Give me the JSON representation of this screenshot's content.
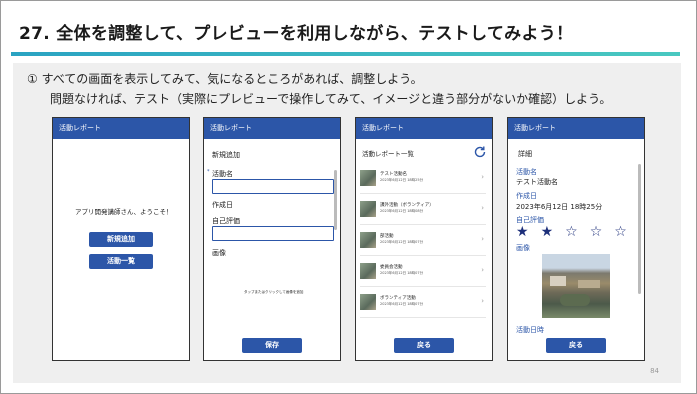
{
  "slide": {
    "title": "27. 全体を調整して、プレビューを利用しながら、テストしてみよう！",
    "line1": "① すべての画面を表示してみて、気になるところがあれば、調整しよう。",
    "line2": "問題なければ、テスト（実際にプレビューで操作してみて、イメージと違う部分がないか確認）しよう。",
    "page_number": "84"
  },
  "colors": {
    "header": "#2c56a8",
    "title_rule": "#2aa3c2",
    "star": "#1d2f7a"
  },
  "phones": {
    "home": {
      "header": "活動レポート",
      "welcome": "アプリ開発講師さん、ようこそ！",
      "btn_new": "新規追加",
      "btn_list": "活動一覧"
    },
    "new": {
      "header": "活動レポート",
      "heading": "新規追加",
      "label_name": "活動名",
      "label_date": "作成日",
      "label_eval": "自己評価",
      "label_image": "画像",
      "image_hint": "タップまたはクリックして画像を追加",
      "btn_save": "保存"
    },
    "list": {
      "header": "活動レポート",
      "heading": "活動レポート一覧",
      "refresh_icon": "refresh-icon",
      "items": [
        {
          "name": "テスト活動名",
          "date": "2023年6月12日 18時25分"
        },
        {
          "name": "課外活動（ボランティア）",
          "date": "2023年6月12日 18時08分"
        },
        {
          "name": "部活動",
          "date": "2023年6月12日 18時07分"
        },
        {
          "name": "委員会活動",
          "date": "2023年6月12日 18時07分"
        },
        {
          "name": "ボランティア活動",
          "date": "2023年6月12日 18時07分"
        }
      ],
      "btn_back": "戻る"
    },
    "detail": {
      "header": "活動レポート",
      "heading": "詳細",
      "label_name": "活動名",
      "value_name": "テスト活動名",
      "label_date": "作成日",
      "value_date": "2023年6月12日 18時25分",
      "label_eval": "自己評価",
      "rating": 2,
      "rating_max": 5,
      "label_image": "画像",
      "label_date2": "活動日時",
      "btn_back": "戻る"
    }
  }
}
